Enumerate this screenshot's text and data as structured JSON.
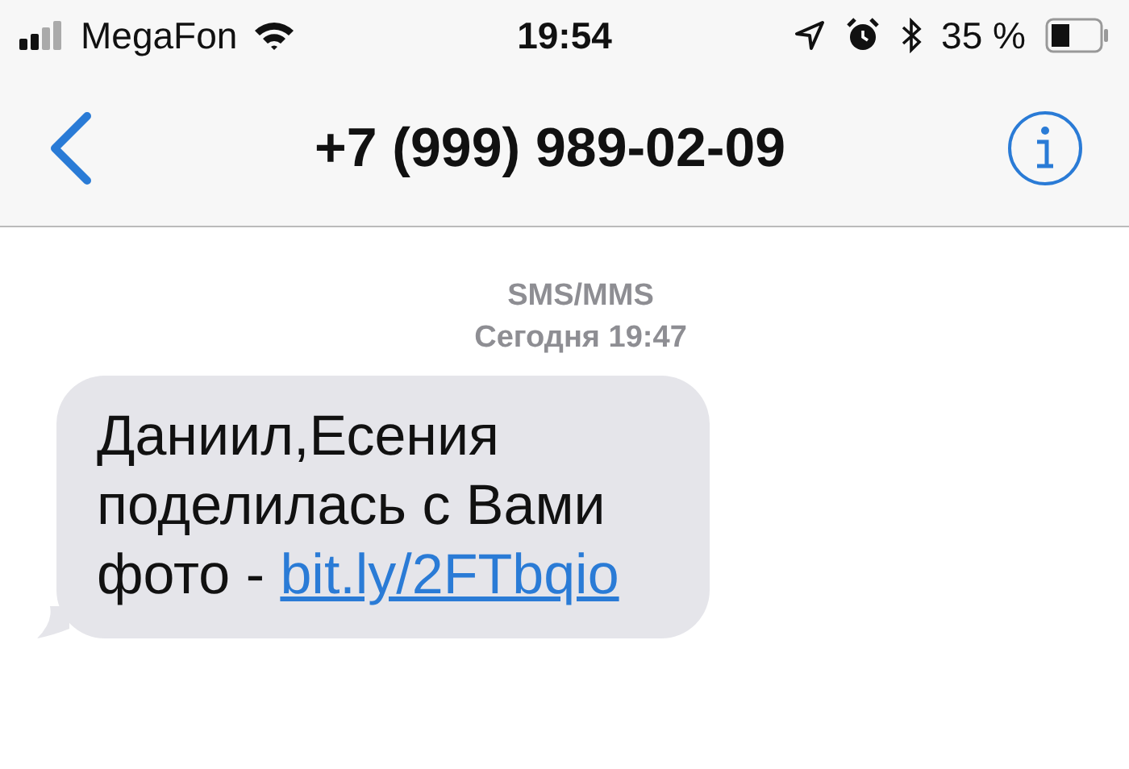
{
  "status_bar": {
    "carrier": "MegaFon",
    "time": "19:54",
    "battery": "35 %"
  },
  "nav_bar": {
    "title": "+7 (999) 989-02-09"
  },
  "conversation": {
    "service": "SMS/MMS",
    "timestamp": "Сегодня 19:47",
    "messages": [
      {
        "kind": "incoming",
        "text": "Даниил,Есения поделилась с Вами фото - ",
        "link": "bit.ly/2FTbqio"
      }
    ]
  }
}
